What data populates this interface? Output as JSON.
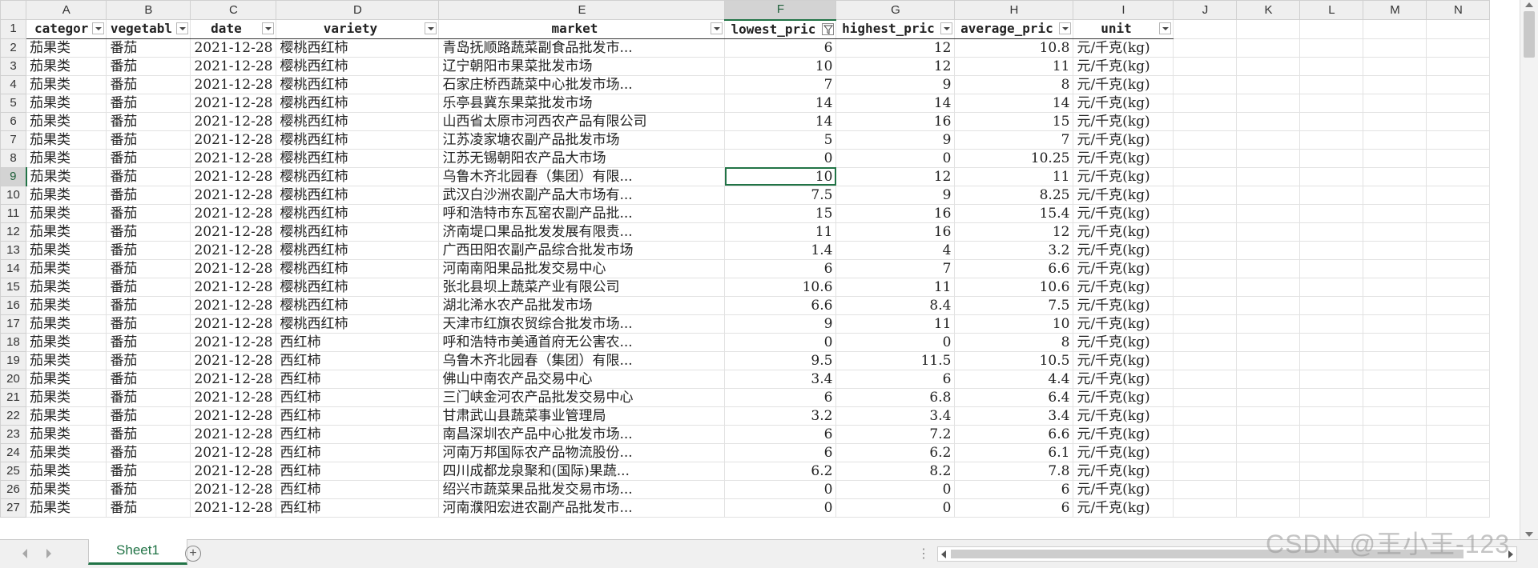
{
  "columns": [
    "A",
    "B",
    "C",
    "D",
    "E",
    "F",
    "G",
    "H",
    "I",
    "J",
    "K",
    "L",
    "M",
    "N"
  ],
  "header_row": [
    "categor",
    "vegetabl",
    "date",
    "variety",
    "market",
    "lowest_pric",
    "highest_pric",
    "average_pric",
    "unit"
  ],
  "rows": [
    [
      "2",
      "茄果类",
      "番茄",
      "2021-12-28",
      "樱桃西红柿",
      "青岛抚顺路蔬菜副食品批发市...",
      "6",
      "12",
      "10.8",
      "元/千克(kg)"
    ],
    [
      "3",
      "茄果类",
      "番茄",
      "2021-12-28",
      "樱桃西红柿",
      "辽宁朝阳市果菜批发市场",
      "10",
      "12",
      "11",
      "元/千克(kg)"
    ],
    [
      "4",
      "茄果类",
      "番茄",
      "2021-12-28",
      "樱桃西红柿",
      "石家庄桥西蔬菜中心批发市场...",
      "7",
      "9",
      "8",
      "元/千克(kg)"
    ],
    [
      "5",
      "茄果类",
      "番茄",
      "2021-12-28",
      "樱桃西红柿",
      "乐亭县冀东果菜批发市场",
      "14",
      "14",
      "14",
      "元/千克(kg)"
    ],
    [
      "6",
      "茄果类",
      "番茄",
      "2021-12-28",
      "樱桃西红柿",
      "山西省太原市河西农产品有限公司",
      "14",
      "16",
      "15",
      "元/千克(kg)"
    ],
    [
      "7",
      "茄果类",
      "番茄",
      "2021-12-28",
      "樱桃西红柿",
      "江苏凌家塘农副产品批发市场",
      "5",
      "9",
      "7",
      "元/千克(kg)"
    ],
    [
      "8",
      "茄果类",
      "番茄",
      "2021-12-28",
      "樱桃西红柿",
      "江苏无锡朝阳农产品大市场",
      "0",
      "0",
      "10.25",
      "元/千克(kg)"
    ],
    [
      "9",
      "茄果类",
      "番茄",
      "2021-12-28",
      "樱桃西红柿",
      "乌鲁木齐北园春（集团）有限...",
      "10",
      "12",
      "11",
      "元/千克(kg)"
    ],
    [
      "10",
      "茄果类",
      "番茄",
      "2021-12-28",
      "樱桃西红柿",
      "武汉白沙洲农副产品大市场有...",
      "7.5",
      "9",
      "8.25",
      "元/千克(kg)"
    ],
    [
      "11",
      "茄果类",
      "番茄",
      "2021-12-28",
      "樱桃西红柿",
      "呼和浩特市东瓦窑农副产品批...",
      "15",
      "16",
      "15.4",
      "元/千克(kg)"
    ],
    [
      "12",
      "茄果类",
      "番茄",
      "2021-12-28",
      "樱桃西红柿",
      "济南堤口果品批发发展有限责...",
      "11",
      "16",
      "12",
      "元/千克(kg)"
    ],
    [
      "13",
      "茄果类",
      "番茄",
      "2021-12-28",
      "樱桃西红柿",
      "广西田阳农副产品综合批发市场",
      "1.4",
      "4",
      "3.2",
      "元/千克(kg)"
    ],
    [
      "14",
      "茄果类",
      "番茄",
      "2021-12-28",
      "樱桃西红柿",
      "河南南阳果品批发交易中心",
      "6",
      "7",
      "6.6",
      "元/千克(kg)"
    ],
    [
      "15",
      "茄果类",
      "番茄",
      "2021-12-28",
      "樱桃西红柿",
      "张北县坝上蔬菜产业有限公司",
      "10.6",
      "11",
      "10.6",
      "元/千克(kg)"
    ],
    [
      "16",
      "茄果类",
      "番茄",
      "2021-12-28",
      "樱桃西红柿",
      "湖北浠水农产品批发市场",
      "6.6",
      "8.4",
      "7.5",
      "元/千克(kg)"
    ],
    [
      "17",
      "茄果类",
      "番茄",
      "2021-12-28",
      "樱桃西红柿",
      "天津市红旗农贸综合批发市场...",
      "9",
      "11",
      "10",
      "元/千克(kg)"
    ],
    [
      "18",
      "茄果类",
      "番茄",
      "2021-12-28",
      "西红柿",
      "呼和浩特市美通首府无公害农...",
      "0",
      "0",
      "8",
      "元/千克(kg)"
    ],
    [
      "19",
      "茄果类",
      "番茄",
      "2021-12-28",
      "西红柿",
      "乌鲁木齐北园春（集团）有限...",
      "9.5",
      "11.5",
      "10.5",
      "元/千克(kg)"
    ],
    [
      "20",
      "茄果类",
      "番茄",
      "2021-12-28",
      "西红柿",
      "佛山中南农产品交易中心",
      "3.4",
      "6",
      "4.4",
      "元/千克(kg)"
    ],
    [
      "21",
      "茄果类",
      "番茄",
      "2021-12-28",
      "西红柿",
      "三门峡金河农产品批发交易中心",
      "6",
      "6.8",
      "6.4",
      "元/千克(kg)"
    ],
    [
      "22",
      "茄果类",
      "番茄",
      "2021-12-28",
      "西红柿",
      "甘肃武山县蔬菜事业管理局",
      "3.2",
      "3.4",
      "3.4",
      "元/千克(kg)"
    ],
    [
      "23",
      "茄果类",
      "番茄",
      "2021-12-28",
      "西红柿",
      "南昌深圳农产品中心批发市场...",
      "6",
      "7.2",
      "6.6",
      "元/千克(kg)"
    ],
    [
      "24",
      "茄果类",
      "番茄",
      "2021-12-28",
      "西红柿",
      "河南万邦国际农产品物流股份...",
      "6",
      "6.2",
      "6.1",
      "元/千克(kg)"
    ],
    [
      "25",
      "茄果类",
      "番茄",
      "2021-12-28",
      "西红柿",
      "四川成都龙泉聚和(国际)果蔬...",
      "6.2",
      "8.2",
      "7.8",
      "元/千克(kg)"
    ],
    [
      "26",
      "茄果类",
      "番茄",
      "2021-12-28",
      "西红柿",
      "绍兴市蔬菜果品批发交易市场...",
      "0",
      "0",
      "6",
      "元/千克(kg)"
    ],
    [
      "27",
      "茄果类",
      "番茄",
      "2021-12-28",
      "西红柿",
      "河南濮阳宏进农副产品批发市...",
      "0",
      "0",
      "6",
      "元/千克(kg)"
    ]
  ],
  "sheet_tab": "Sheet1",
  "add_sheet_symbol": "+",
  "scroll_dots": "⋮",
  "watermark": "CSDN @王小王-123"
}
